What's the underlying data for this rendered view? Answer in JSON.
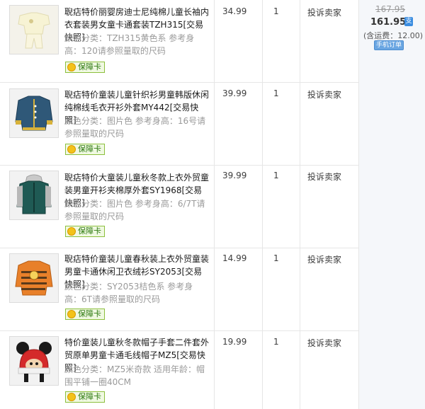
{
  "items": [
    {
      "title": "聣痁特价丽婴房迪士尼纯棉儿童长袖内衣套装男女童卡通套装TZH315[交易快照]",
      "meta": "颜色分类：TZH315黄色系  参考身高：120请参照量取的尺码",
      "price": "34.99",
      "qty": "1",
      "complain": "投诉卖家",
      "badge": "保障卡",
      "thumb_icon": "cream-pajama-set-photo"
    },
    {
      "title": "聣痁特价童装儿童针织衫男童韩版休闲纯棉线毛衣开衫外套MY442[交易快照]",
      "meta": "颜色分类：图片色  参考身高：16号请参照量取的尺码",
      "price": "39.99",
      "qty": "1",
      "complain": "投诉卖家",
      "badge": "保障卡",
      "thumb_icon": "navy-cardigan-photo"
    },
    {
      "title": "聣痁特价大童装儿童秋冬款上衣外贸童装男童开衫夹棉厚外套SY1968[交易快照]",
      "meta": "颜色分类：图片色  参考身高：6/7T请参照量取的尺码",
      "price": "39.99",
      "qty": "1",
      "complain": "投诉卖家",
      "badge": "保障卡",
      "thumb_icon": "green-hooded-jacket-photo"
    },
    {
      "title": "聣痁特价童装儿童春秋装上衣外贸童装男童卡通休闲卫衣绒衫SY2053[交易快照]",
      "meta": "颜色分类：SY2053桔色系  参考身高：6T请参照量取的尺码",
      "price": "14.99",
      "qty": "1",
      "complain": "投诉卖家",
      "badge": "保障卡",
      "thumb_icon": "orange-striped-sweatshirt-photo"
    },
    {
      "title": "特价童装儿童秋冬款帽子手套二件套外贸原单男童卡通毛线帽子MZ5[交易快照]",
      "meta": "颜色分类：MZ5米奇款  适用年龄：帽围平铺一圈40CM",
      "price": "19.99",
      "qty": "1",
      "complain": "投诉卖家",
      "badge": "保障卡",
      "thumb_icon": "mickey-knit-hat-photo"
    }
  ],
  "summary": {
    "original_total": "167.95",
    "total": "161.95",
    "pay_icon": "支",
    "shipping": "(含运费：12.00)",
    "mobile_order": "手机订单"
  },
  "colors": {
    "title": "#1a1a1a",
    "meta": "#9a9a9a",
    "badge_green": "#2e7a10",
    "link_blue": "#3b8de0"
  }
}
